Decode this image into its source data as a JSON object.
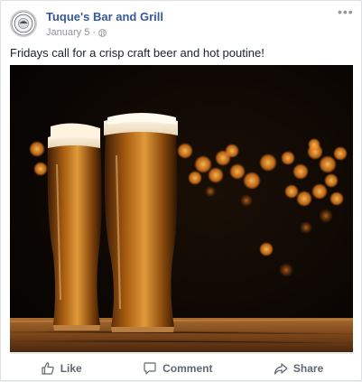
{
  "post": {
    "page_name": "Tuque's Bar and Grill",
    "date": "January 5",
    "separator": "·",
    "privacy_icon": "globe-icon",
    "more_icon": "more-options-icon",
    "text": "Fridays call for a crisp craft beer and hot poutine!",
    "photo_description_icon": "post-photo"
  },
  "actions": {
    "like_label": "Like",
    "comment_label": "Comment",
    "share_label": "Share"
  },
  "colors": {
    "page_name": "#365899",
    "meta": "#90949c",
    "action_text": "#606770",
    "beer_amber": "#c8781e",
    "bokeh": "#ff9a2e"
  }
}
